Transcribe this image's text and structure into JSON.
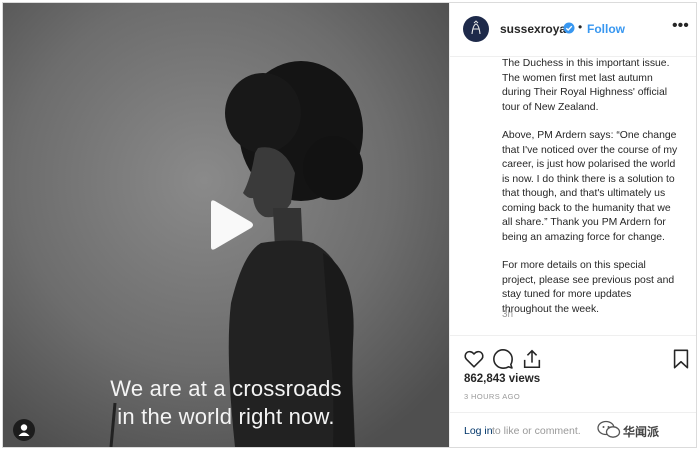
{
  "overlay": {
    "caption_line1": "We are at a crossroads",
    "caption_line2": "in the world right now."
  },
  "header": {
    "username": "sussexroyal",
    "separator": "•",
    "follow_label": "Follow",
    "more_label": "•••"
  },
  "caption": {
    "lines_p1": [
      "The Duchess in this important issue.",
      "The women first met last autumn",
      "during Their Royal Highness' official",
      "tour of New Zealand."
    ],
    "lines_p2": [
      "Above, PM Ardern says: “One change",
      "that I've noticed over the course of my",
      "career, is just how polarised the world",
      "is now. I do think there is a solution to",
      "that though, and that's ultimately us",
      "coming back to the humanity that we",
      "all share.” Thank you PM Ardern for",
      "being an amazing force for change."
    ],
    "lines_p3": [
      "For more details on this special",
      "project, please see previous post and",
      "stay tuned for more updates",
      "throughout the week."
    ],
    "time": "3h"
  },
  "stats": {
    "views": "862,843 views",
    "ago": "3 HOURS AGO"
  },
  "login": {
    "link": "Log in",
    "rest": "to like or comment."
  },
  "watermark": {
    "text": "华闻派"
  },
  "colors": {
    "accent": "#3897f0",
    "text": "#262626",
    "muted": "#999999",
    "border": "#dbdbdb"
  }
}
